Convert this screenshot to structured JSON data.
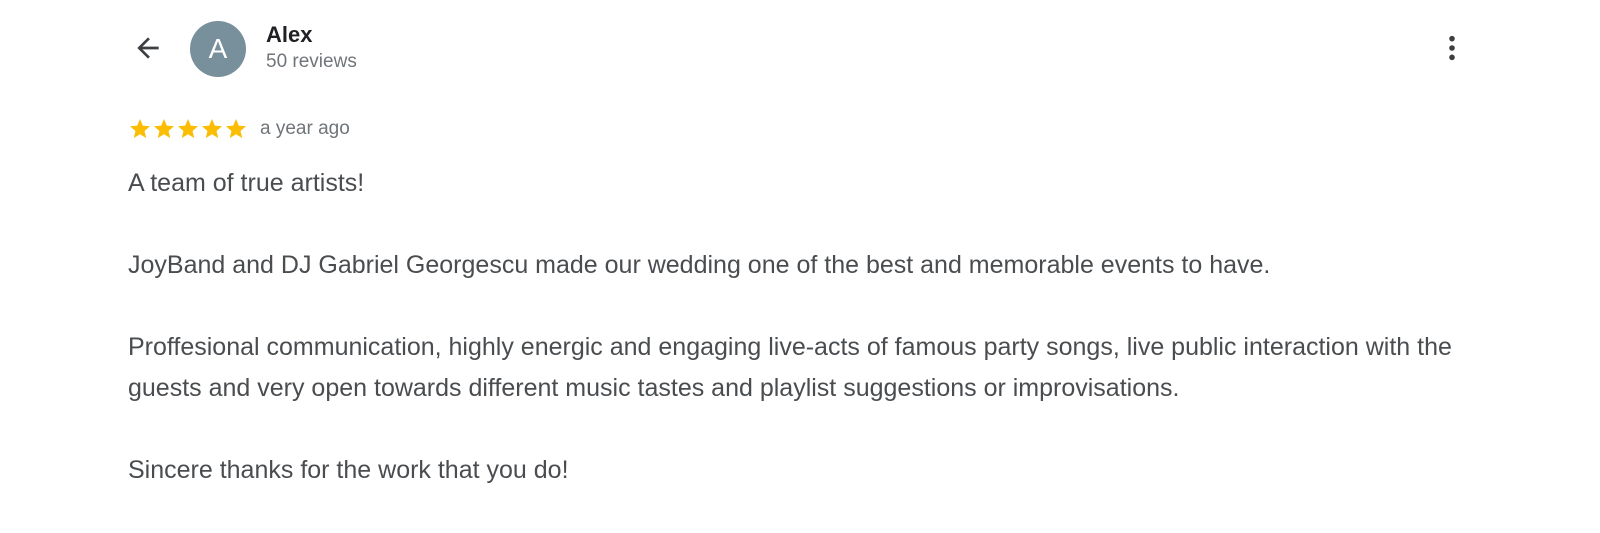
{
  "header": {
    "back_icon": "arrow-back-icon",
    "more_icon": "more-vert-icon"
  },
  "user": {
    "avatar_letter": "A",
    "avatar_color": "#78909c",
    "name": "Alex",
    "review_count": "50 reviews"
  },
  "review": {
    "rating": 5,
    "rating_max": 5,
    "star_color": "#fbbc04",
    "time": "a year ago",
    "paragraphs": [
      "A team of true artists!",
      "JoyBand and DJ Gabriel Georgescu made our wedding one of the best and memorable events to have.",
      "Proffesional communication, highly energic and engaging live-acts of famous party songs, live public interaction with the guests and very open towards different music tastes and playlist suggestions or improvisations.",
      "Sincere thanks for the work that you do!"
    ]
  }
}
